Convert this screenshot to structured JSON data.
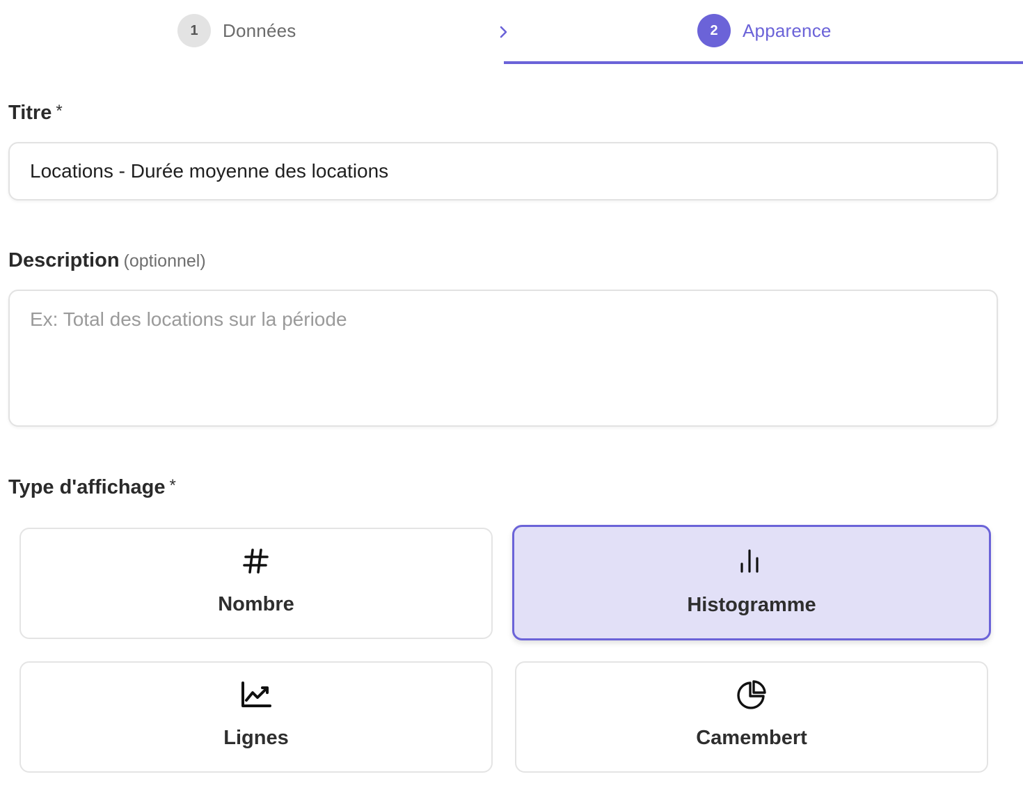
{
  "stepper": {
    "steps": [
      {
        "number": "1",
        "label": "Données",
        "state": "done"
      },
      {
        "number": "2",
        "label": "Apparence",
        "state": "active"
      }
    ],
    "separator_icon": "chevron-right-icon",
    "accent_color": "#6b63d8"
  },
  "form": {
    "title": {
      "label": "Titre",
      "required_mark": "*",
      "value": "Locations - Durée moyenne des locations"
    },
    "description": {
      "label": "Description",
      "optional_note": "(optionnel)",
      "value": "",
      "placeholder": "Ex: Total des locations sur la période"
    },
    "display_type": {
      "label": "Type d'affichage",
      "required_mark": "*",
      "selected": "Histogramme",
      "options": [
        {
          "label": "Nombre",
          "icon": "hash-icon"
        },
        {
          "label": "Histogramme",
          "icon": "bar-chart-icon"
        },
        {
          "label": "Lignes",
          "icon": "line-chart-icon"
        },
        {
          "label": "Camembert",
          "icon": "pie-chart-icon"
        }
      ]
    }
  }
}
